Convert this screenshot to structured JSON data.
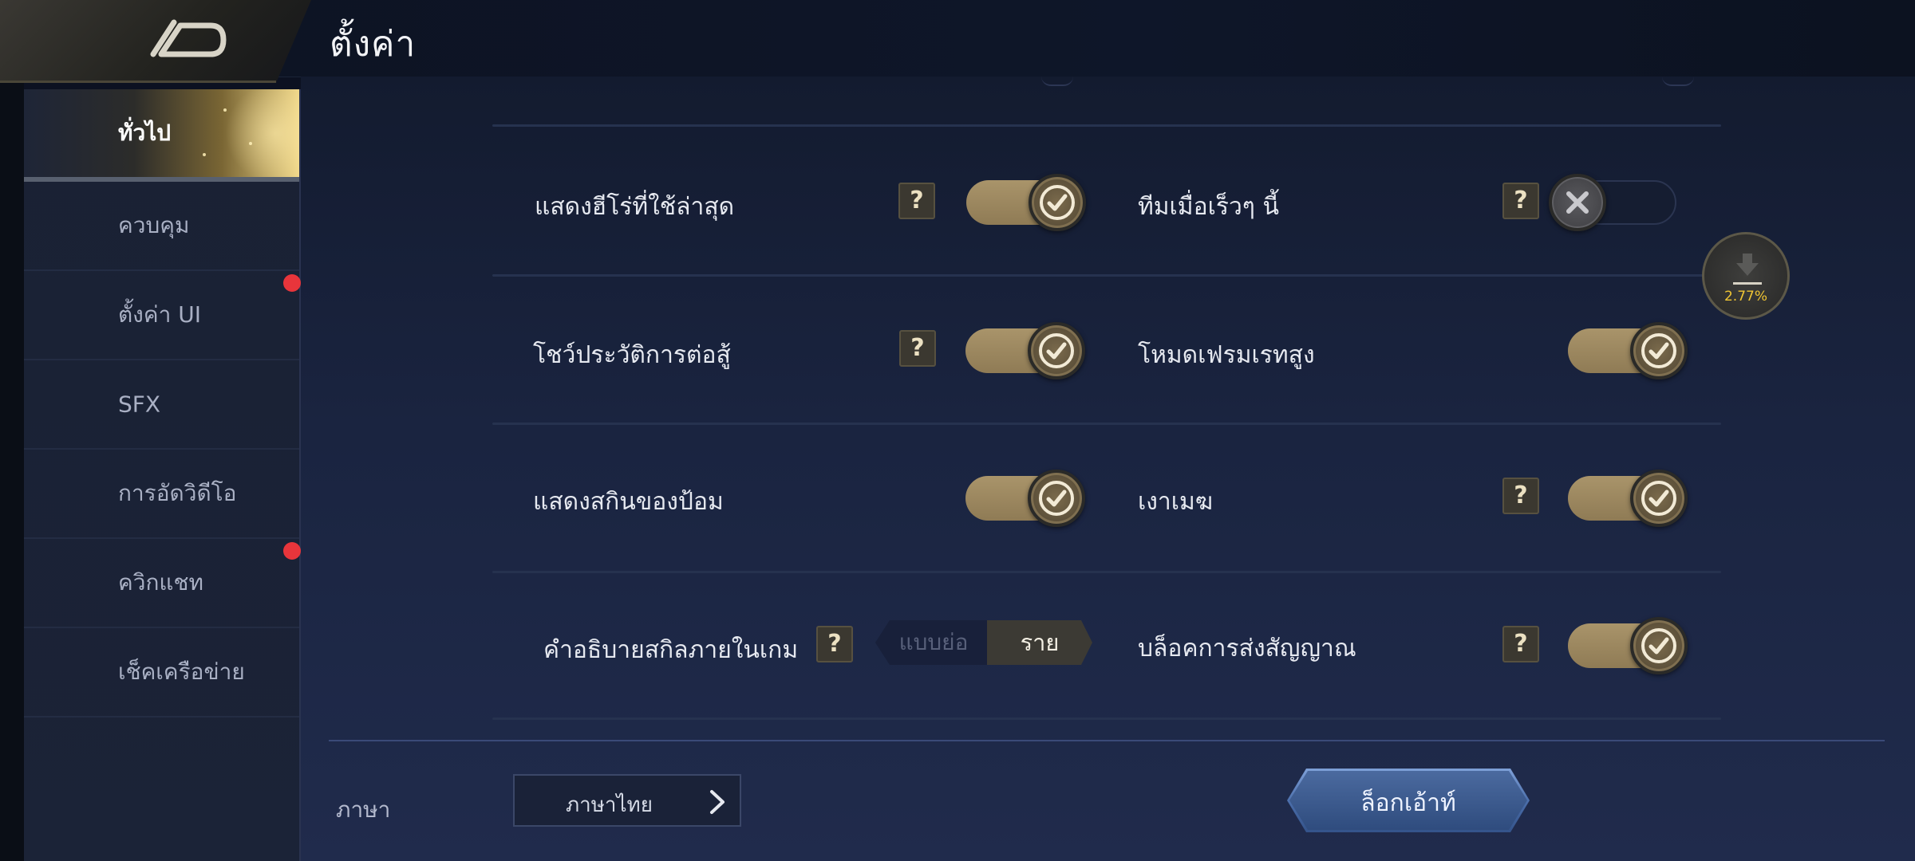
{
  "header": {
    "title": "ตั้งค่า",
    "back_icon": "back-arrow-icon"
  },
  "sidebar": {
    "items": [
      {
        "label": "ทั่วไป",
        "active": true,
        "notification": false
      },
      {
        "label": "ควบคุม",
        "active": false,
        "notification": false
      },
      {
        "label": "ตั้งค่า UI",
        "active": false,
        "notification": true
      },
      {
        "label": "SFX",
        "active": false,
        "notification": false
      },
      {
        "label": "การอัดวิดีโอ",
        "active": false,
        "notification": false
      },
      {
        "label": "ควิกแชท",
        "active": false,
        "notification": true
      },
      {
        "label": "เช็คเครือข่าย",
        "active": false,
        "notification": false
      }
    ]
  },
  "settings": {
    "help_glyph": "?",
    "recent_heroes": {
      "label": "แสดงฮีโร่ที่ใช้ล่าสุด",
      "enabled": true
    },
    "recent_team": {
      "label": "ทีมเมื่อเร็วๆ นี้",
      "enabled": false
    },
    "battle_history": {
      "label": "โชว์ประวัติการต่อสู้",
      "enabled": true
    },
    "high_framerate": {
      "label": "โหมดเฟรมเรทสูง",
      "enabled": true
    },
    "turret_skin": {
      "label": "แสดงสกินของป้อม",
      "enabled": true
    },
    "cloud_shadow": {
      "label": "เงาเมฆ",
      "enabled": true
    },
    "skill_desc": {
      "label": "คำอธิบายสกิลภายในเกม",
      "options": [
        "แบบย่อ",
        "รายละเอียด"
      ],
      "selected": "รายละเอียด"
    },
    "block_signal": {
      "label": "บล็อคการส่งสัญญาณ",
      "enabled": true
    }
  },
  "footer": {
    "language_label": "ภาษา",
    "language_value": "ภาษาไทย",
    "logout_label": "ล็อกเอ้าท์"
  },
  "download": {
    "progress_text": "2.77%",
    "progress": 0.0277
  },
  "colors": {
    "accent_gold": "#a9946a",
    "notification_red": "#e8353b",
    "logout_blue": "#496ca8"
  }
}
